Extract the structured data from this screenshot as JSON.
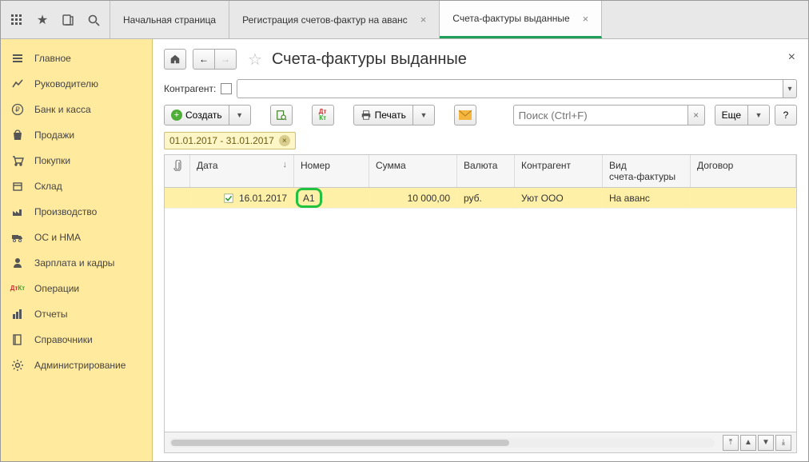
{
  "tabs": [
    {
      "label": "Начальная страница"
    },
    {
      "label": "Регистрация счетов-фактур на аванс"
    },
    {
      "label": "Счета-фактуры выданные"
    }
  ],
  "active_tab_index": 2,
  "sidebar": [
    {
      "label": "Главное",
      "icon": "menu"
    },
    {
      "label": "Руководителю",
      "icon": "chart"
    },
    {
      "label": "Банк и касса",
      "icon": "ruble"
    },
    {
      "label": "Продажи",
      "icon": "bag"
    },
    {
      "label": "Покупки",
      "icon": "cart"
    },
    {
      "label": "Склад",
      "icon": "box"
    },
    {
      "label": "Производство",
      "icon": "factory"
    },
    {
      "label": "ОС и НМА",
      "icon": "truck"
    },
    {
      "label": "Зарплата и кадры",
      "icon": "person"
    },
    {
      "label": "Операции",
      "icon": "dtkt"
    },
    {
      "label": "Отчеты",
      "icon": "bars"
    },
    {
      "label": "Справочники",
      "icon": "book"
    },
    {
      "label": "Администрирование",
      "icon": "gear"
    }
  ],
  "page": {
    "title": "Счета-фактуры выданные",
    "filter_label": "Контрагент:",
    "create_label": "Создать",
    "print_label": "Печать",
    "more_label": "Еще",
    "help_label": "?",
    "search_placeholder": "Поиск (Ctrl+F)",
    "date_chip": "01.01.2017 - 31.01.2017"
  },
  "grid": {
    "headers": {
      "clip": "",
      "date": "Дата",
      "number": "Номер",
      "sum": "Сумма",
      "currency": "Валюта",
      "counterparty": "Контрагент",
      "type": "Вид\nсчета-фактуры",
      "contract": "Договор"
    },
    "rows": [
      {
        "date": "16.01.2017",
        "number": "А1",
        "sum": "10 000,00",
        "currency": "руб.",
        "counterparty": "Уют ООО",
        "type": "На аванс",
        "contract": ""
      }
    ]
  }
}
